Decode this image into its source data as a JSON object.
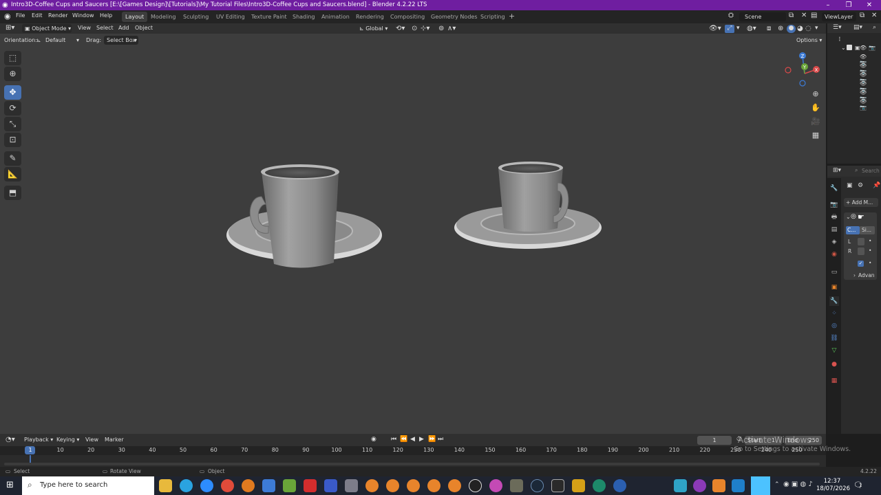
{
  "window": {
    "title": "Intro3D-Coffee Cups and Saucers [E:\\[Games Design]\\[Tutorials]\\My Tutorial Files\\Intro3D-Coffee Cups and Saucers.blend] - Blender 4.2.22 LTS",
    "minimize": "–",
    "maximize": "❐",
    "close": "✕"
  },
  "menu": {
    "file": "File",
    "edit": "Edit",
    "render": "Render",
    "window": "Window",
    "help": "Help"
  },
  "workspaces": [
    "Layout",
    "Modeling",
    "Sculpting",
    "UV Editing",
    "Texture Paint",
    "Shading",
    "Animation",
    "Rendering",
    "Compositing",
    "Geometry Nodes",
    "Scripting"
  ],
  "add_workspace": "+",
  "scene": {
    "label": "Scene",
    "view_layer": "ViewLayer"
  },
  "viewport_header": {
    "mode": "Object Mode",
    "view": "View",
    "select": "Select",
    "add": "Add",
    "object": "Object",
    "transform_orientation": "Global"
  },
  "tool_settings": {
    "orientation_label": "Orientation:",
    "orientation_value": "Default",
    "drag_label": "Drag:",
    "drag_value": "Select Box",
    "options": "Options"
  },
  "gizmo": {
    "z": "Z",
    "y": "Y",
    "x": "X"
  },
  "properties": {
    "add_modifier": "Add M...",
    "tab_c": "C...",
    "tab_s": "Si...",
    "l": "L",
    "r": "R",
    "advanced": "Advan"
  },
  "search_placeholder": "Search",
  "timeline": {
    "playback": "Playback",
    "keying": "Keying",
    "view": "View",
    "marker": "Marker",
    "current_frame": "1",
    "start": "Start",
    "start_value": "1",
    "end": "End",
    "end_value": "250",
    "ticks": [
      "1",
      "10",
      "20",
      "30",
      "40",
      "50",
      "60",
      "70",
      "80",
      "90",
      "100",
      "110",
      "120",
      "130",
      "140",
      "150",
      "160",
      "170",
      "180",
      "190",
      "200",
      "210",
      "220",
      "230",
      "240",
      "250"
    ]
  },
  "status": {
    "select": "Select",
    "rotate_view": "Rotate View",
    "object": "Object",
    "version": "4.2.22"
  },
  "watermark": {
    "line1": "Activate Windows",
    "line2": "Go to Settings to activate Windows."
  },
  "taskbar": {
    "search_placeholder": "Type here to search",
    "time": "12:37",
    "date": "18/07/2026",
    "notif_count": "1"
  }
}
